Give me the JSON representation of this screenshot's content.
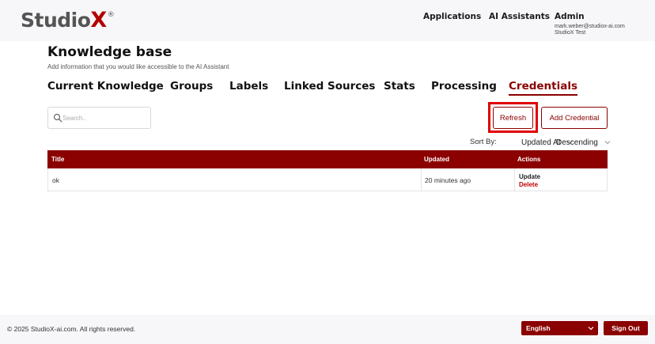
{
  "header": {
    "logo": {
      "text": "Studio",
      "x": "X",
      "reg": "®"
    },
    "nav": [
      {
        "label": "Applications"
      },
      {
        "label": "AI Assistants"
      }
    ],
    "user": {
      "name": "Admin",
      "email": "mark.weber@studiox-ai.com",
      "org": "StudioX Test"
    }
  },
  "page": {
    "title": "Knowledge base",
    "subtitle": "Add information that you would like accessible to the AI Assistant"
  },
  "tabs": [
    {
      "label": "Current Knowledge"
    },
    {
      "label": "Groups"
    },
    {
      "label": "Labels"
    },
    {
      "label": "Linked Sources"
    },
    {
      "label": "Stats"
    },
    {
      "label": "Processing"
    },
    {
      "label": "Credentials",
      "active": true
    }
  ],
  "toolbar": {
    "search_placeholder": "Search..",
    "refresh_label": "Refresh",
    "add_label": "Add Credential"
  },
  "sort": {
    "label": "Sort By:",
    "field": "Updated At",
    "direction": "Descending"
  },
  "table": {
    "columns": [
      "Title",
      "Updated",
      "Actions"
    ],
    "rows": [
      {
        "title": "ok",
        "updated": "20 minutes ago",
        "actions": [
          "Update",
          "Delete"
        ]
      }
    ]
  },
  "footer": {
    "copyright": "© 2025 StudioX-ai.com.  All rights reserved.",
    "language": "English",
    "signout_label": "Sign Out"
  },
  "colors": {
    "accent": "#8b0000",
    "highlight": "#e00000"
  }
}
